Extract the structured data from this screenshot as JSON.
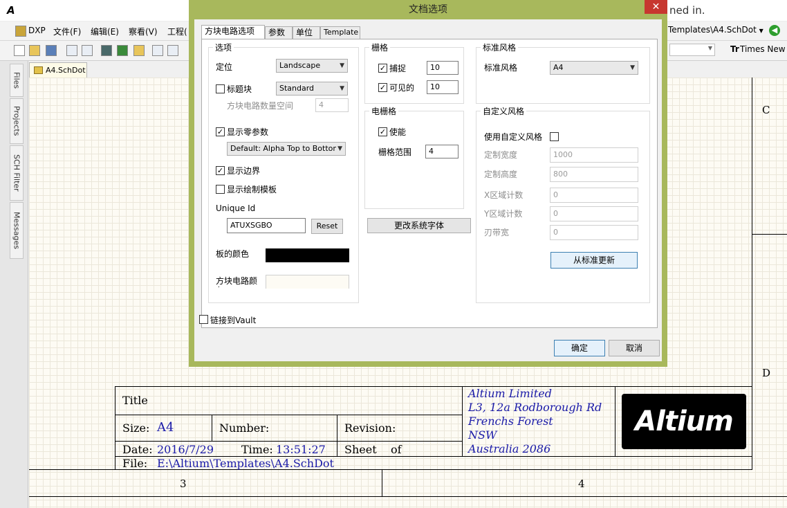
{
  "app": {
    "title_fragment": "ned in.",
    "logo_text": "A",
    "menu": [
      "DXP",
      "文件(F)",
      "编辑(E)",
      "察看(V)",
      "工程("
    ],
    "path_combo": "Templates\\A4.SchDot",
    "font_combo": "Times New",
    "side_tabs": [
      "Files",
      "Projects",
      "SCH Filter",
      "Messages"
    ],
    "doc_tab": "A4.SchDot"
  },
  "sheet": {
    "zone_c": "C",
    "zone_d": "D",
    "col_3": "3",
    "col_4": "4",
    "title_label": "Title",
    "size_label": "Size:",
    "size_value": "A4",
    "number_label": "Number:",
    "revision_label": "Revision:",
    "date_label": "Date:",
    "date_value": "2016/7/29",
    "time_label": "Time:",
    "time_value": "13:51:27",
    "sheet_label": "Sheet",
    "of_label": "of",
    "file_label": "File:",
    "file_value": "E:\\Altium\\Templates\\A4.SchDot",
    "address": [
      "Altium Limited",
      "L3, 12a Rodborough Rd",
      "Frenchs Forest",
      "NSW",
      "Australia 2086"
    ],
    "logo": "Altium"
  },
  "dialog": {
    "title": "文档选项",
    "close": "✕",
    "tabs": [
      "方块电路选项",
      "参数",
      "单位",
      "Template"
    ],
    "options": {
      "title": "选项",
      "orientation_label": "定位",
      "orientation_value": "Landscape",
      "title_block_label": "标题块",
      "title_block_value": "Standard",
      "sheet_number_spaces_label": "方块电路数量空间",
      "sheet_number_spaces_value": "4",
      "show_ref_zones_label": "显示零参数",
      "ref_zones_style": "Default: Alpha Top to Bottom",
      "show_border_label": "显示边界",
      "show_template_graphics_label": "显示绘制模板",
      "unique_id_label": "Unique Id",
      "unique_id_value": "ATUXSGBO",
      "reset_label": "Reset",
      "border_color_label": "板的颜色",
      "sheet_color_label": "方块电路颜色"
    },
    "grids": {
      "title": "栅格",
      "snap_label": "捕捉",
      "snap_value": "10",
      "visible_label": "可见的",
      "visible_value": "10"
    },
    "electrical_grid": {
      "title": "电栅格",
      "enable_label": "使能",
      "range_label": "栅格范围",
      "range_value": "4"
    },
    "change_font_label": "更改系统字体",
    "standard_style": {
      "title": "标准风格",
      "label": "标准风格",
      "value": "A4"
    },
    "custom_style": {
      "title": "自定义风格",
      "use_label": "使用自定义风格",
      "width_label": "定制宽度",
      "width_value": "1000",
      "height_label": "定制高度",
      "height_value": "800",
      "x_zones_label": "X区域计数",
      "x_zones_value": "0",
      "y_zones_label": "Y区域计数",
      "y_zones_value": "0",
      "margin_label": "刃带宽",
      "margin_value": "0",
      "update_label": "从标准更新"
    },
    "link_vault_label": "链接到Vault",
    "ok_label": "确定",
    "cancel_label": "取消"
  },
  "colors": {
    "dialog_frame": "#a8b85c",
    "border_color": "#000000",
    "sheet_color": "#fdfbf4",
    "title_blue": "#1a1aa8"
  }
}
